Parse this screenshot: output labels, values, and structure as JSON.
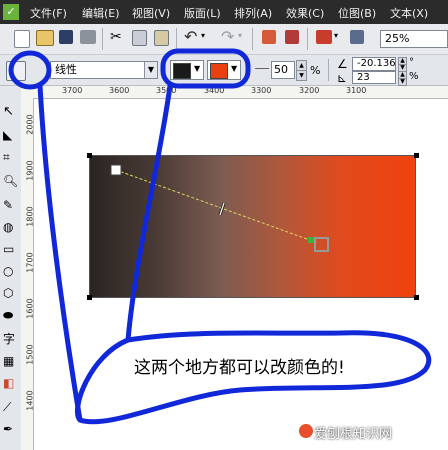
{
  "menu": {
    "items": [
      "文件(F)",
      "编辑(E)",
      "视图(V)",
      "版面(L)",
      "排列(A)",
      "效果(C)",
      "位图(B)",
      "文本(X)"
    ]
  },
  "toolbar": {
    "zoom_value": "25%"
  },
  "property_bar": {
    "fill_type": "线性",
    "start_color": "#1a1a1a",
    "end_color": "#e8400f",
    "midpoint_value": "50",
    "midpoint_unit": "%",
    "angle_value": "-20.136",
    "edge_pad_value": "23",
    "angle_unit": "°",
    "edge_unit": "%"
  },
  "ruler_top": {
    "ticks": [
      "3700",
      "3600",
      "3500",
      "3400",
      "3300",
      "3200",
      "3100"
    ]
  },
  "ruler_left": {
    "ticks": [
      "2000",
      "1900",
      "1800",
      "1700",
      "1600",
      "1500",
      "1400"
    ]
  },
  "toolbox": {
    "text_tool_label": "字"
  },
  "annotation": {
    "text": "这两个地方都可以改颜色的!"
  },
  "watermark": {
    "text": "爱刨根知识网"
  },
  "colors": {
    "annotation_blue": "#1128d8",
    "gradient_start": "#2a2522",
    "gradient_end": "#ef420e"
  }
}
